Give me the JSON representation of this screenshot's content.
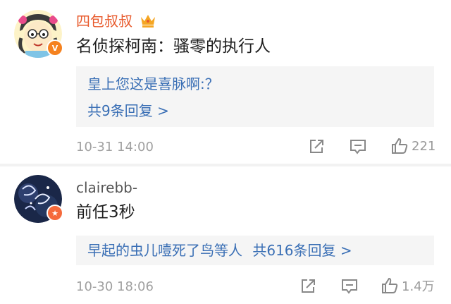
{
  "comments": [
    {
      "username": "四包叔叔",
      "text": "名侦探柯南：骚零的执行人",
      "reply_preview": "皇上您这是喜脉啊:？",
      "reply_more": "共9条回复 >",
      "timestamp": "10-31 14:00",
      "likes": "221",
      "name_color": "#e8592b",
      "badge": "V"
    },
    {
      "username": "clairebb-",
      "text": "前任3秒",
      "reply_preview": "早起的虫儿噎死了鸟等人",
      "reply_more": "共616条回复 >",
      "timestamp": "10-30 18:06",
      "likes": "1.4万",
      "name_color": "#555555",
      "badge": "★"
    }
  ],
  "icons": [
    "vip-crown-icon",
    "share-icon",
    "comment-icon",
    "like-icon"
  ]
}
